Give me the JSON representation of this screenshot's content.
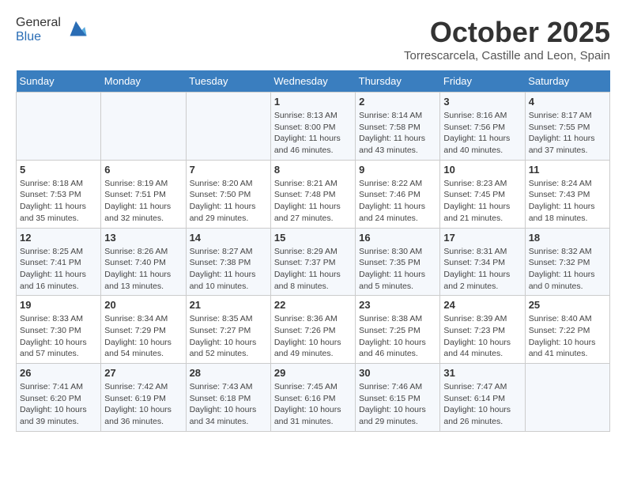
{
  "header": {
    "logo_line1": "General",
    "logo_line2": "Blue",
    "month": "October 2025",
    "location": "Torrescarcela, Castille and Leon, Spain"
  },
  "days_of_week": [
    "Sunday",
    "Monday",
    "Tuesday",
    "Wednesday",
    "Thursday",
    "Friday",
    "Saturday"
  ],
  "weeks": [
    [
      {
        "day": "",
        "content": ""
      },
      {
        "day": "",
        "content": ""
      },
      {
        "day": "",
        "content": ""
      },
      {
        "day": "1",
        "content": "Sunrise: 8:13 AM\nSunset: 8:00 PM\nDaylight: 11 hours and 46 minutes."
      },
      {
        "day": "2",
        "content": "Sunrise: 8:14 AM\nSunset: 7:58 PM\nDaylight: 11 hours and 43 minutes."
      },
      {
        "day": "3",
        "content": "Sunrise: 8:16 AM\nSunset: 7:56 PM\nDaylight: 11 hours and 40 minutes."
      },
      {
        "day": "4",
        "content": "Sunrise: 8:17 AM\nSunset: 7:55 PM\nDaylight: 11 hours and 37 minutes."
      }
    ],
    [
      {
        "day": "5",
        "content": "Sunrise: 8:18 AM\nSunset: 7:53 PM\nDaylight: 11 hours and 35 minutes."
      },
      {
        "day": "6",
        "content": "Sunrise: 8:19 AM\nSunset: 7:51 PM\nDaylight: 11 hours and 32 minutes."
      },
      {
        "day": "7",
        "content": "Sunrise: 8:20 AM\nSunset: 7:50 PM\nDaylight: 11 hours and 29 minutes."
      },
      {
        "day": "8",
        "content": "Sunrise: 8:21 AM\nSunset: 7:48 PM\nDaylight: 11 hours and 27 minutes."
      },
      {
        "day": "9",
        "content": "Sunrise: 8:22 AM\nSunset: 7:46 PM\nDaylight: 11 hours and 24 minutes."
      },
      {
        "day": "10",
        "content": "Sunrise: 8:23 AM\nSunset: 7:45 PM\nDaylight: 11 hours and 21 minutes."
      },
      {
        "day": "11",
        "content": "Sunrise: 8:24 AM\nSunset: 7:43 PM\nDaylight: 11 hours and 18 minutes."
      }
    ],
    [
      {
        "day": "12",
        "content": "Sunrise: 8:25 AM\nSunset: 7:41 PM\nDaylight: 11 hours and 16 minutes."
      },
      {
        "day": "13",
        "content": "Sunrise: 8:26 AM\nSunset: 7:40 PM\nDaylight: 11 hours and 13 minutes."
      },
      {
        "day": "14",
        "content": "Sunrise: 8:27 AM\nSunset: 7:38 PM\nDaylight: 11 hours and 10 minutes."
      },
      {
        "day": "15",
        "content": "Sunrise: 8:29 AM\nSunset: 7:37 PM\nDaylight: 11 hours and 8 minutes."
      },
      {
        "day": "16",
        "content": "Sunrise: 8:30 AM\nSunset: 7:35 PM\nDaylight: 11 hours and 5 minutes."
      },
      {
        "day": "17",
        "content": "Sunrise: 8:31 AM\nSunset: 7:34 PM\nDaylight: 11 hours and 2 minutes."
      },
      {
        "day": "18",
        "content": "Sunrise: 8:32 AM\nSunset: 7:32 PM\nDaylight: 11 hours and 0 minutes."
      }
    ],
    [
      {
        "day": "19",
        "content": "Sunrise: 8:33 AM\nSunset: 7:30 PM\nDaylight: 10 hours and 57 minutes."
      },
      {
        "day": "20",
        "content": "Sunrise: 8:34 AM\nSunset: 7:29 PM\nDaylight: 10 hours and 54 minutes."
      },
      {
        "day": "21",
        "content": "Sunrise: 8:35 AM\nSunset: 7:27 PM\nDaylight: 10 hours and 52 minutes."
      },
      {
        "day": "22",
        "content": "Sunrise: 8:36 AM\nSunset: 7:26 PM\nDaylight: 10 hours and 49 minutes."
      },
      {
        "day": "23",
        "content": "Sunrise: 8:38 AM\nSunset: 7:25 PM\nDaylight: 10 hours and 46 minutes."
      },
      {
        "day": "24",
        "content": "Sunrise: 8:39 AM\nSunset: 7:23 PM\nDaylight: 10 hours and 44 minutes."
      },
      {
        "day": "25",
        "content": "Sunrise: 8:40 AM\nSunset: 7:22 PM\nDaylight: 10 hours and 41 minutes."
      }
    ],
    [
      {
        "day": "26",
        "content": "Sunrise: 7:41 AM\nSunset: 6:20 PM\nDaylight: 10 hours and 39 minutes."
      },
      {
        "day": "27",
        "content": "Sunrise: 7:42 AM\nSunset: 6:19 PM\nDaylight: 10 hours and 36 minutes."
      },
      {
        "day": "28",
        "content": "Sunrise: 7:43 AM\nSunset: 6:18 PM\nDaylight: 10 hours and 34 minutes."
      },
      {
        "day": "29",
        "content": "Sunrise: 7:45 AM\nSunset: 6:16 PM\nDaylight: 10 hours and 31 minutes."
      },
      {
        "day": "30",
        "content": "Sunrise: 7:46 AM\nSunset: 6:15 PM\nDaylight: 10 hours and 29 minutes."
      },
      {
        "day": "31",
        "content": "Sunrise: 7:47 AM\nSunset: 6:14 PM\nDaylight: 10 hours and 26 minutes."
      },
      {
        "day": "",
        "content": ""
      }
    ]
  ]
}
